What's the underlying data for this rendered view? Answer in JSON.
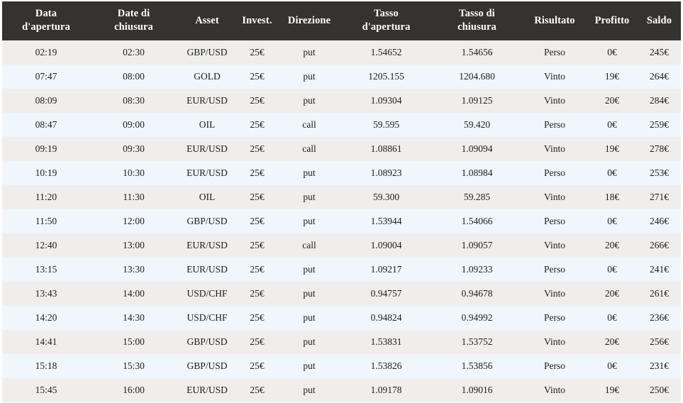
{
  "table": {
    "columns": [
      {
        "key": "open_date",
        "label": "Data\nd'apertura"
      },
      {
        "key": "close_date",
        "label": "Date di\nchiusura"
      },
      {
        "key": "asset",
        "label": "Asset"
      },
      {
        "key": "invest",
        "label": "Invest."
      },
      {
        "key": "direction",
        "label": "Direzione"
      },
      {
        "key": "open_rate",
        "label": "Tasso\nd'apertura"
      },
      {
        "key": "close_rate",
        "label": "Tasso di\nchiusura"
      },
      {
        "key": "result",
        "label": "Risultato"
      },
      {
        "key": "profit",
        "label": "Profitto"
      },
      {
        "key": "balance",
        "label": "Saldo"
      }
    ],
    "rows": [
      [
        "02:19",
        "02:30",
        "GBP/USD",
        "25€",
        "put",
        "1.54652",
        "1.54656",
        "Perso",
        "0€",
        "245€"
      ],
      [
        "07:47",
        "08:00",
        "GOLD",
        "25€",
        "put",
        "1205.155",
        "1204.680",
        "Vinto",
        "19€",
        "264€"
      ],
      [
        "08:09",
        "08:30",
        "EUR/USD",
        "25€",
        "put",
        "1.09304",
        "1.09125",
        "Vinto",
        "20€",
        "284€"
      ],
      [
        "08:47",
        "09:00",
        "OIL",
        "25€",
        "call",
        "59.595",
        "59.420",
        "Perso",
        "0€",
        "259€"
      ],
      [
        "09:19",
        "09:30",
        "EUR/USD",
        "25€",
        "call",
        "1.08861",
        "1.09094",
        "Vinto",
        "19€",
        "278€"
      ],
      [
        "10:19",
        "10:30",
        "EUR/USD",
        "25€",
        "put",
        "1.08923",
        "1.08984",
        "Perso",
        "0€",
        "253€"
      ],
      [
        "11:20",
        "11:30",
        "OIL",
        "25€",
        "put",
        "59.300",
        "59.285",
        "Vinto",
        "18€",
        "271€"
      ],
      [
        "11:50",
        "12:00",
        "GBP/USD",
        "25€",
        "put",
        "1.53944",
        "1.54066",
        "Perso",
        "0€",
        "246€"
      ],
      [
        "12:40",
        "13:00",
        "EUR/USD",
        "25€",
        "call",
        "1.09004",
        "1.09057",
        "Vinto",
        "20€",
        "266€"
      ],
      [
        "13:15",
        "13:30",
        "EUR/USD",
        "25€",
        "put",
        "1.09217",
        "1.09233",
        "Perso",
        "0€",
        "241€"
      ],
      [
        "13:43",
        "14:00",
        "USD/CHF",
        "25€",
        "put",
        "0.94757",
        "0.94678",
        "Vinto",
        "20€",
        "261€"
      ],
      [
        "14:20",
        "14:30",
        "USD/CHF",
        "25€",
        "put",
        "0.94824",
        "0.94992",
        "Perso",
        "0€",
        "236€"
      ],
      [
        "14:41",
        "15:00",
        "GBP/USD",
        "25€",
        "put",
        "1.53831",
        "1.53752",
        "Vinto",
        "20€",
        "256€"
      ],
      [
        "15:18",
        "15:30",
        "GBP/USD",
        "25€",
        "put",
        "1.53826",
        "1.53856",
        "Perso",
        "0€",
        "231€"
      ],
      [
        "15:45",
        "16:00",
        "EUR/USD",
        "25€",
        "put",
        "1.09178",
        "1.09016",
        "Vinto",
        "19€",
        "250€"
      ]
    ]
  },
  "colors": {
    "header_bg": "#35332f",
    "header_text": "#ffffff",
    "row_odd_bg": "#efeeec",
    "row_even_bg": "#eff6fc",
    "cell_text": "#1d1d1d",
    "page_bg": "#ffffff"
  }
}
